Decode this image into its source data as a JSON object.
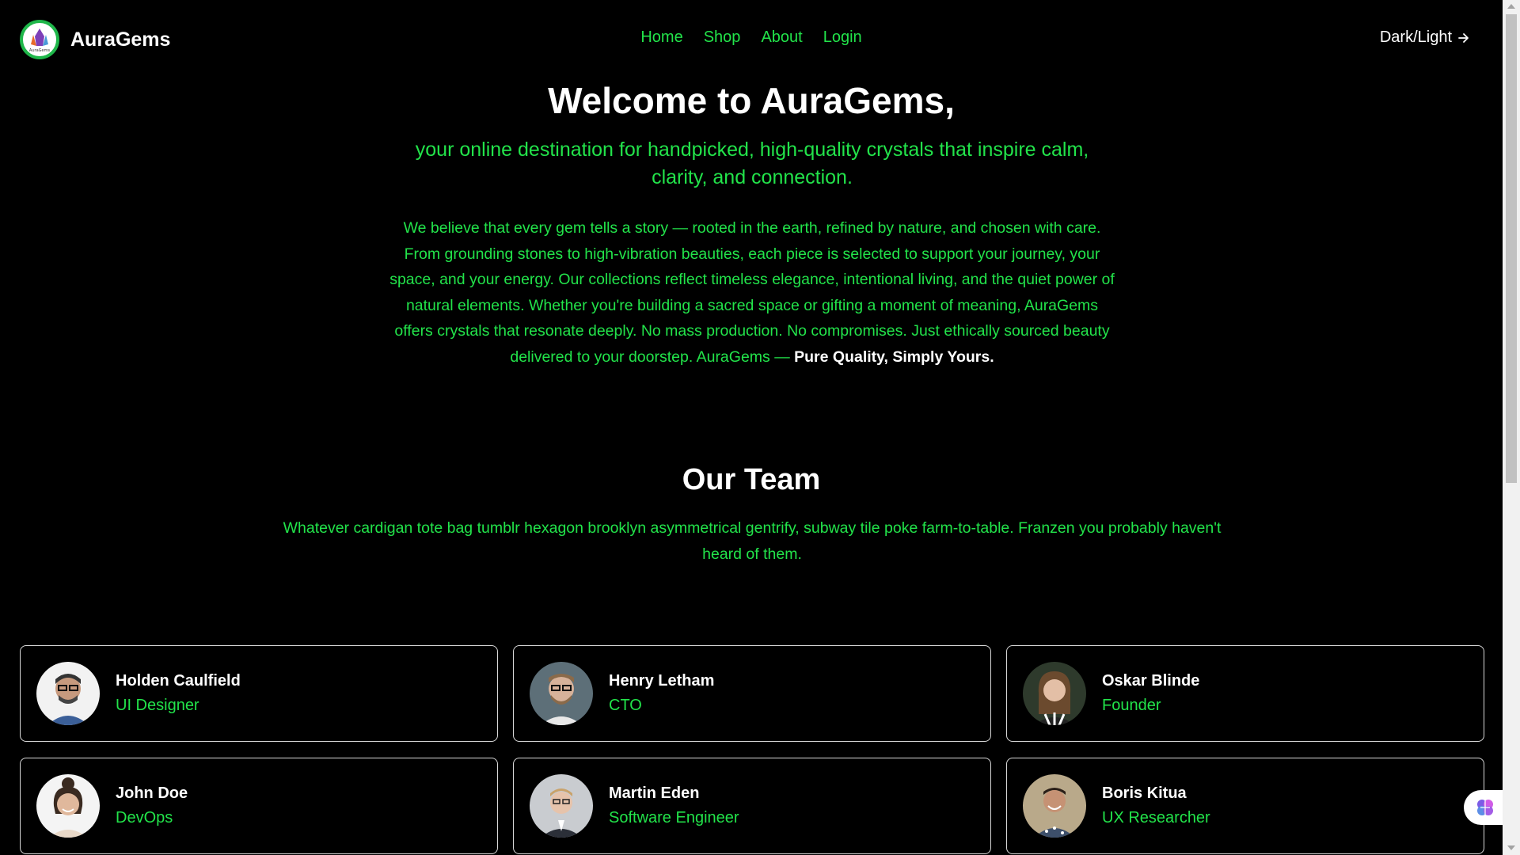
{
  "header": {
    "brand": "AuraGems",
    "logo_text": "AuraGems",
    "nav": [
      "Home",
      "Shop",
      "About",
      "Login"
    ],
    "theme_toggle": "Dark/Light"
  },
  "hero": {
    "title": "Welcome to AuraGems,",
    "subtitle": "your online destination for handpicked, high-quality crystals that inspire calm, clarity, and connection.",
    "body": "We believe that every gem tells a story — rooted in the earth, refined by nature, and chosen with care. From grounding stones to high-vibration beauties, each piece is selected to support your journey, your space, and your energy. Our collections reflect timeless elegance, intentional living, and the quiet power of natural elements. Whether you're building a sacred space or gifting a moment of meaning, AuraGems offers crystals that resonate deeply. No mass production. No compromises. Just ethically sourced beauty delivered to your doorstep. AuraGems —",
    "tagline": "Pure Quality, Simply Yours."
  },
  "team": {
    "title": "Our Team",
    "subtitle": "Whatever cardigan tote bag tumblr hexagon brooklyn asymmetrical gentrify, subway tile poke farm-to-table. Franzen you probably haven't heard of them.",
    "members": [
      {
        "name": "Holden Caulfield",
        "role": "UI Designer"
      },
      {
        "name": "Henry Letham",
        "role": "CTO"
      },
      {
        "name": "Oskar Blinde",
        "role": "Founder"
      },
      {
        "name": "John Doe",
        "role": "DevOps"
      },
      {
        "name": "Martin Eden",
        "role": "Software Engineer"
      },
      {
        "name": "Boris Kitua",
        "role": "UX Researcher"
      }
    ]
  },
  "colors": {
    "background": "#000000",
    "accent_green": "#22e34a",
    "text": "#ffffff",
    "card_border": "#d8d8d8"
  },
  "icons": {
    "theme_toggle": "arrow-right-icon",
    "floating_button": "brain-icon",
    "logo": "crystal-logo-icon"
  }
}
